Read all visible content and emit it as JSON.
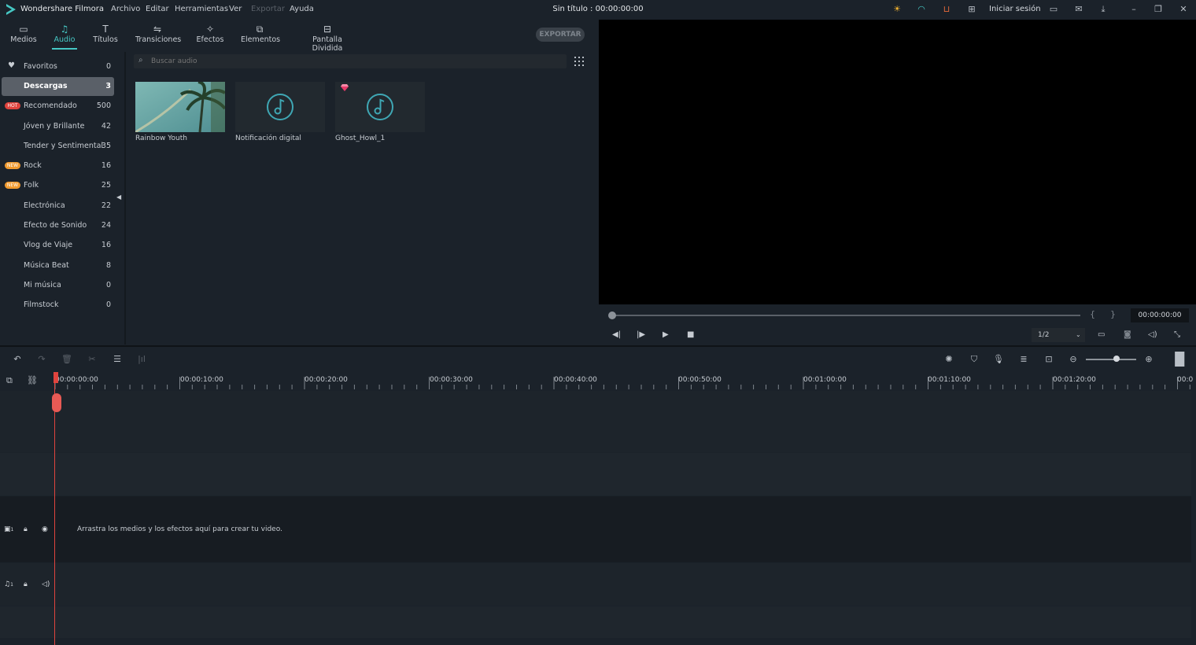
{
  "app": {
    "name": "Wondershare Filmora",
    "document_title": "Sin título : 00:00:00:00",
    "menu": [
      "Archivo",
      "Editar",
      "Herramientas",
      "Ver",
      "Exportar",
      "Ayuda"
    ],
    "sign_in": "Iniciar sesión"
  },
  "tabs": [
    {
      "label": "Medios",
      "icon": "folder-icon"
    },
    {
      "label": "Audio",
      "icon": "music-note-icon"
    },
    {
      "label": "Títulos",
      "icon": "text-icon"
    },
    {
      "label": "Transiciones",
      "icon": "transition-icon"
    },
    {
      "label": "Efectos",
      "icon": "effects-icon"
    },
    {
      "label": "Elementos",
      "icon": "elements-icon"
    },
    {
      "label": "Pantalla Dividida",
      "icon": "split-screen-icon"
    }
  ],
  "export_button": "EXPORTAR",
  "categories": [
    {
      "label": "Favoritos",
      "count": "0",
      "badge": "heart"
    },
    {
      "label": "Descargas",
      "count": "3",
      "badge": ""
    },
    {
      "label": "Recomendado",
      "count": "500",
      "badge": "HOT"
    },
    {
      "label": "Jóven y Brillante",
      "count": "42",
      "badge": ""
    },
    {
      "label": "Tender y Sentimental",
      "count": "35",
      "badge": ""
    },
    {
      "label": "Rock",
      "count": "16",
      "badge": "NEW"
    },
    {
      "label": "Folk",
      "count": "25",
      "badge": "NEW"
    },
    {
      "label": "Electrónica",
      "count": "22",
      "badge": ""
    },
    {
      "label": "Efecto de Sonido",
      "count": "24",
      "badge": ""
    },
    {
      "label": "Vlog de Viaje",
      "count": "16",
      "badge": ""
    },
    {
      "label": "Música Beat",
      "count": "8",
      "badge": ""
    },
    {
      "label": "Mi música",
      "count": "0",
      "badge": ""
    },
    {
      "label": "Filmstock",
      "count": "0",
      "badge": ""
    }
  ],
  "search": {
    "placeholder": "Buscar audio"
  },
  "audio_items": [
    {
      "name": "Rainbow Youth",
      "thumb": "photo"
    },
    {
      "name": "Notificación digital",
      "thumb": "music-note"
    },
    {
      "name": "Ghost_Howl_1",
      "thumb": "music-note",
      "premium": true
    }
  ],
  "preview": {
    "time": "00:00:00:00",
    "quality": "1/2"
  },
  "timeline": {
    "ruler": [
      "00:00:00:00",
      "00:00:10:00",
      "00:00:20:00",
      "00:00:30:00",
      "00:00:40:00",
      "00:00:50:00",
      "00:01:00:00",
      "00:01:10:00",
      "00:01:20:00",
      "00:0"
    ],
    "drop_hint": "Arrastra los medios y los efectos aquí para crear tu video.",
    "video_track_label": "1",
    "audio_track_label": "1"
  },
  "colors": {
    "accent": "#46c8c4",
    "playhead": "#e0443e",
    "hot": "#e0443e",
    "new": "#f09a2f"
  }
}
